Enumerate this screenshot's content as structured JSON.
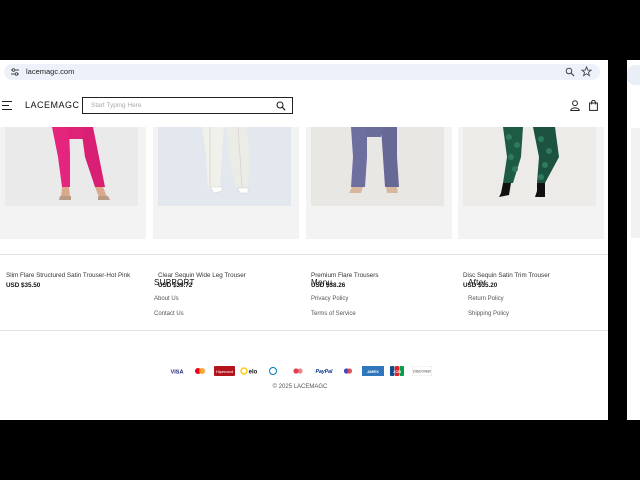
{
  "browser": {
    "url": "lacemagc.com"
  },
  "header": {
    "logo": "LACEMAGC",
    "search_placeholder": "Start Typing Here"
  },
  "products": [
    {
      "name": "Slim Flare Structured Satin Trouser-Hot Pink",
      "price": "USD $35.50"
    },
    {
      "name": "Clear Sequin Wide Leg Trouser",
      "price": "USD $39.72"
    },
    {
      "name": "Premium Flare Trousers",
      "price": "USD $38.26"
    },
    {
      "name": "Disc Sequin Satin Trim Trouser",
      "price": "USD $35.20"
    }
  ],
  "footer": {
    "columns": [
      {
        "title": "SUPPORT",
        "links": [
          "About Us",
          "Contact Us"
        ]
      },
      {
        "title": "Menu",
        "links": [
          "Privacy Policy",
          "Terms of Service"
        ]
      },
      {
        "title": "After",
        "links": [
          "Return Policy",
          "Shipping Policy"
        ]
      }
    ],
    "payment_methods": [
      "visa",
      "mastercard",
      "hipercard",
      "elo",
      "diners",
      "maestro",
      "paypal",
      "mastercard-2",
      "amex",
      "jcb",
      "discover"
    ],
    "payment_labels": {
      "visa": "VISA",
      "hipercard": "Hipercard",
      "elo": "elo",
      "paypal": "PayPal",
      "amex": "AMEX",
      "jcb": "JCB",
      "discover": "DISCOVER"
    },
    "copyright": "© 2025 LACEMAGC"
  },
  "colors": {
    "hot_pink": "#e4247d",
    "white_trouser": "#eeeeea",
    "blue_trouser": "#6d6f9e",
    "green_sequin": "#1e5b45"
  }
}
